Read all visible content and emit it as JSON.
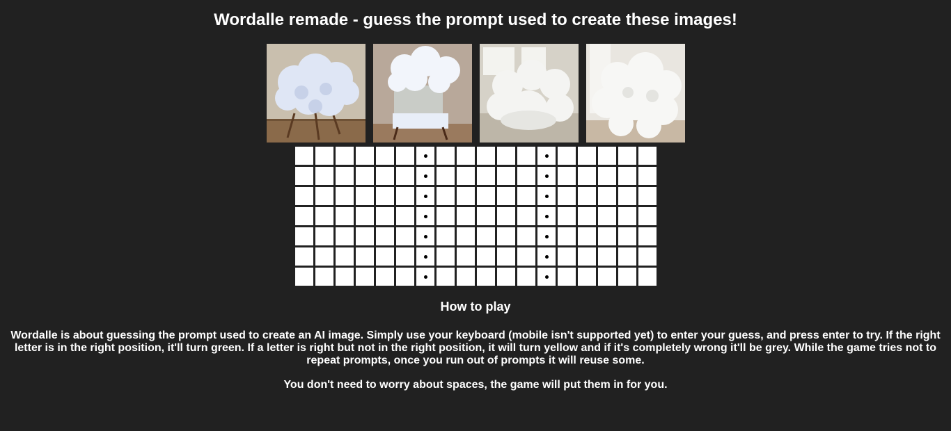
{
  "header": {
    "title": "Wordalle remade - guess the prompt used to create these images!"
  },
  "images": [
    {
      "name": "cloud-chair-image-1"
    },
    {
      "name": "cloud-chair-image-2"
    },
    {
      "name": "cloud-chair-image-3"
    },
    {
      "name": "cloud-chair-image-4"
    }
  ],
  "board": {
    "rows": 7,
    "columns": 18,
    "space_columns": [
      6,
      12
    ],
    "space_marker": "•"
  },
  "how_to_play": {
    "heading": "How to play",
    "description": "Wordalle is about guessing the prompt used to create an AI image. Simply use your keyboard (mobile isn't supported yet) to enter your guess, and press enter to try. If the right letter is in the right position, it'll turn green. If a letter is right but not in the right position, it will turn yellow and if it's completely wrong it'll be grey. While the game tries not to repeat prompts, once you run out of prompts it will reuse some.",
    "note": "You don't need to worry about spaces, the game will put them in for you."
  },
  "colors": {
    "background": "#212121",
    "tile": "#ffffff",
    "text": "#ffffff"
  }
}
